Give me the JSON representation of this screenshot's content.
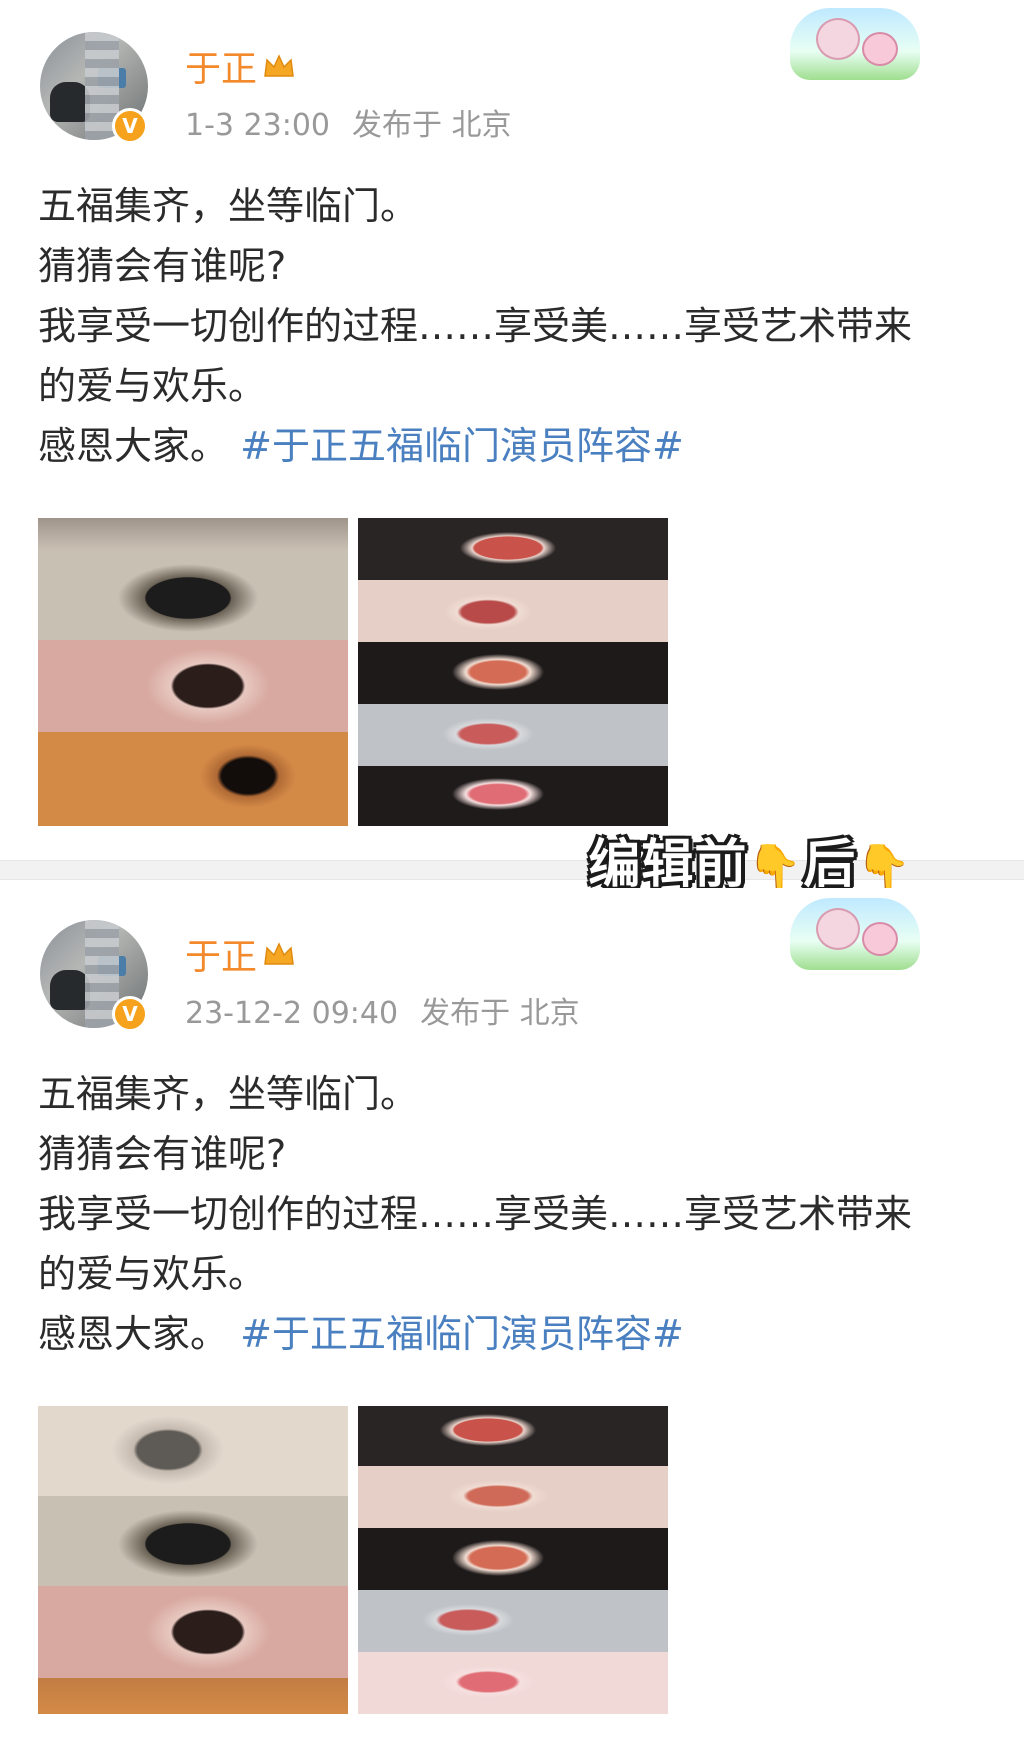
{
  "edit_label": {
    "before": "编辑前",
    "after": "后",
    "hand_icon": "👇"
  },
  "posts": [
    {
      "name": "于正",
      "time": "1-3 23:00",
      "location": "发布于 北京",
      "lines": [
        "五福集齐，坐等临门。",
        "猜猜会有谁呢?",
        "我享受一切创作的过程……享受美……享受艺术带来",
        "的爱与欢乐。"
      ],
      "last_line": "感恩大家。",
      "hashtag": "#于正五福临门演员阵容#"
    },
    {
      "name": "于正",
      "time": "23-12-2 09:40",
      "location": "发布于 北京",
      "lines": [
        "五福集齐，坐等临门。",
        "猜猜会有谁呢?",
        "我享受一切创作的过程……享受美……享受艺术带来",
        "的爱与欢乐。"
      ],
      "last_line": "感恩大家。",
      "hashtag": "#于正五福临门演员阵容#"
    }
  ],
  "badge": "V"
}
